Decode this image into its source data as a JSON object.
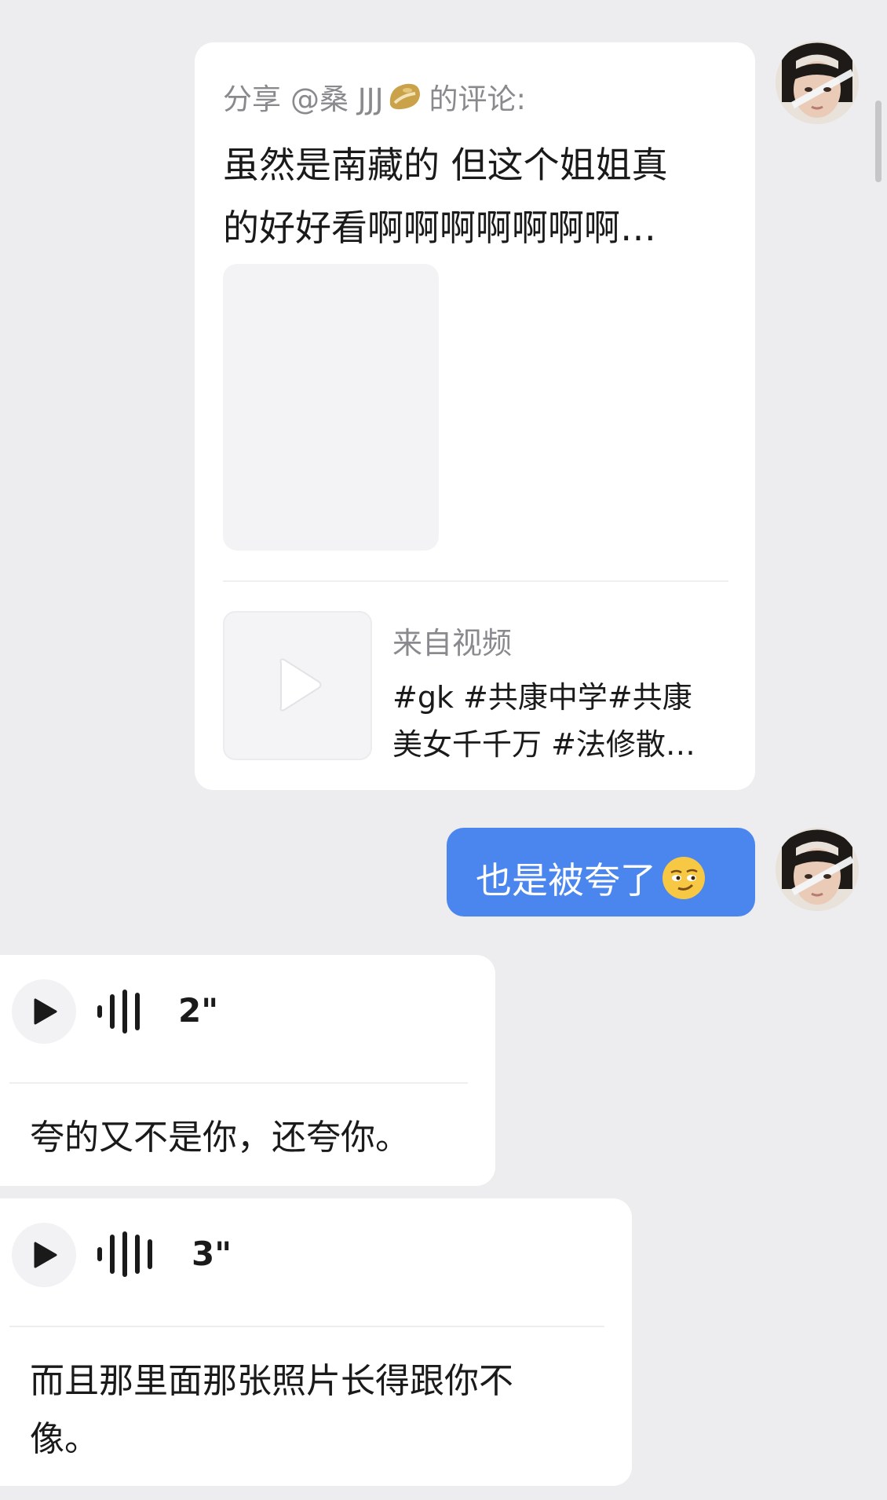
{
  "share_card": {
    "share_prefix": "分享",
    "mention": "@桑 JJJ",
    "share_suffix": "的评论:",
    "comment_lines": [
      "虽然是南藏的 但这个姐姐真",
      "的好好看啊啊啊啊啊啊啊…"
    ],
    "video_from_label": "来自视频",
    "video_title_lines": [
      "#gk #共康中学#共康",
      "美女千千万 #法修散…"
    ]
  },
  "my_message": {
    "text": "也是被夸了",
    "emoji": "smirk-face-emoji"
  },
  "voice_messages": [
    {
      "duration": "2\"",
      "transcript_lines": [
        "夸的又不是你，还夸你。"
      ]
    },
    {
      "duration": "3\"",
      "transcript_lines": [
        "而且那里面那张照片长得跟你不",
        "像。"
      ]
    }
  ],
  "colors": {
    "background": "#ededef",
    "bubble_blue": "#4b86ee",
    "card": "#ffffff",
    "muted_text": "#8a8a8e"
  }
}
